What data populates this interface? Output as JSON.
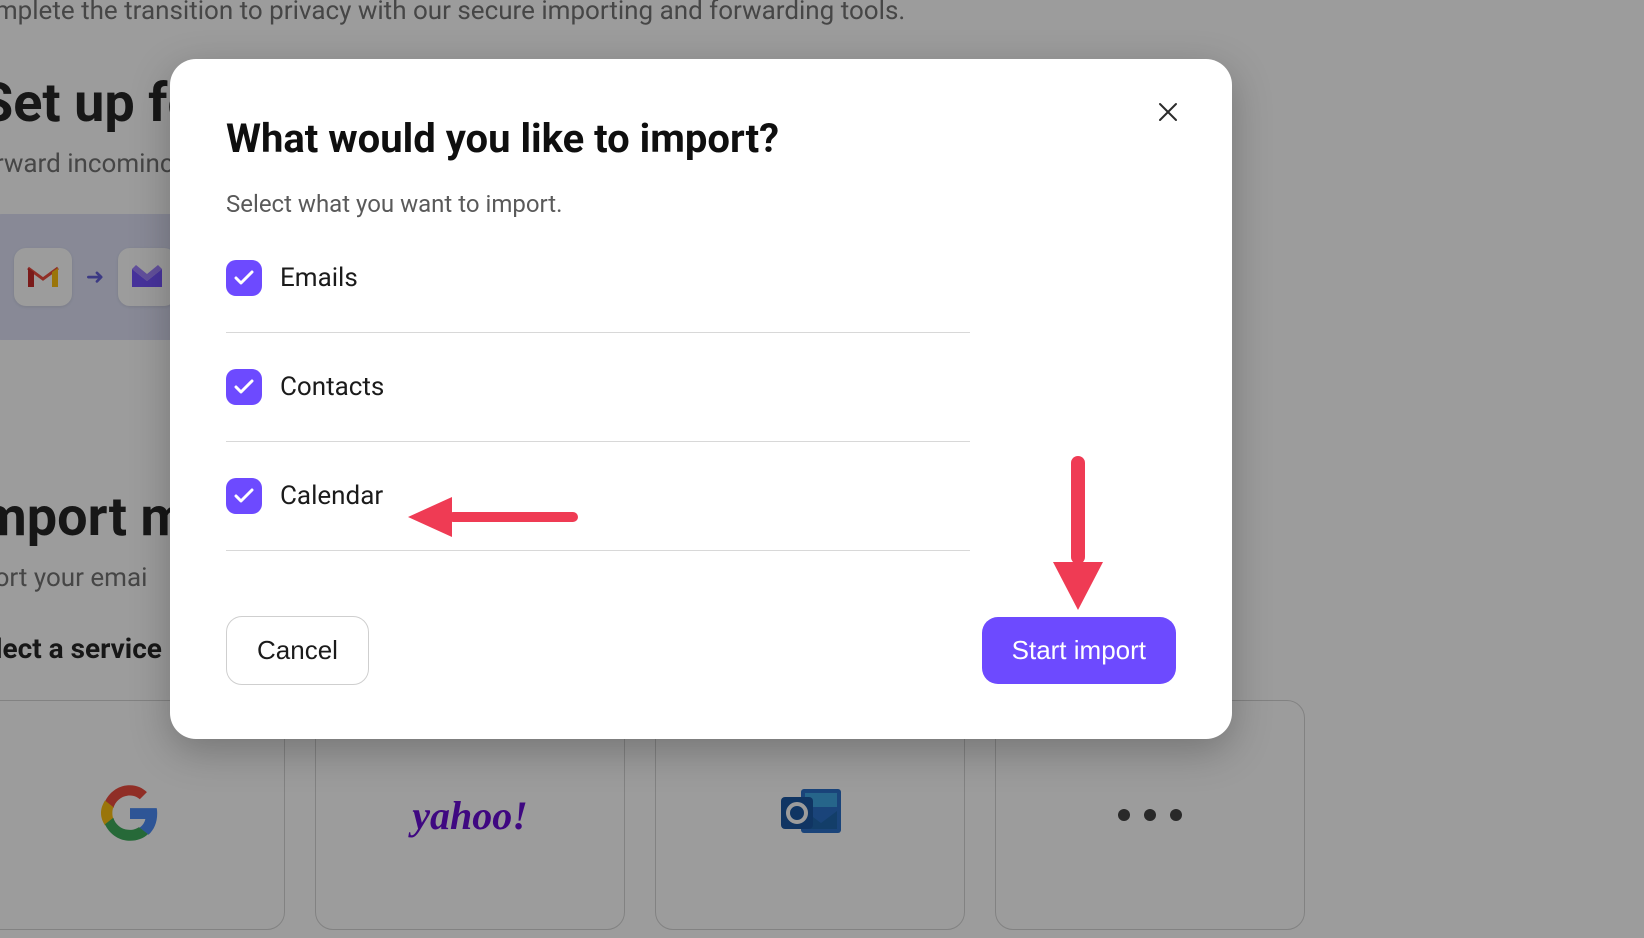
{
  "background": {
    "top_line": "omplete the transition to privacy with our secure importing and forwarding tools.",
    "setup_heading": "Set up fo",
    "setup_sub": "orward incominc",
    "import_heading": "mport m",
    "import_sub": "port your emai",
    "select_service_label": "elect a service",
    "services": {
      "yahoo_logo": "yahoo!"
    },
    "colors": {
      "accent": "#6d4aff"
    }
  },
  "modal": {
    "title": "What would you like to import?",
    "subtitle": "Select what you want to import.",
    "options": [
      {
        "label": "Emails",
        "checked": true
      },
      {
        "label": "Contacts",
        "checked": true
      },
      {
        "label": "Calendar",
        "checked": true
      }
    ],
    "cancel_label": "Cancel",
    "primary_label": "Start import"
  },
  "annotations": {
    "arrow_calendar": true,
    "arrow_start_import": true,
    "color": "#ef3b54"
  }
}
